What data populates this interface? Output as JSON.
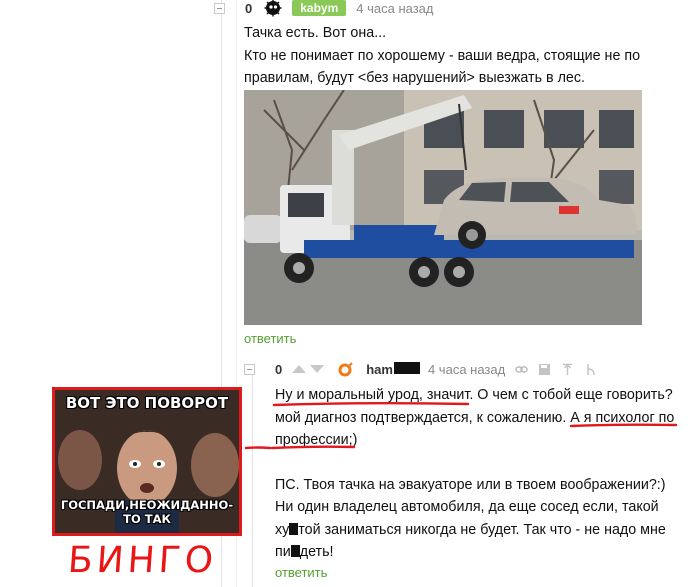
{
  "comment1": {
    "rating": "0",
    "author_badge": "kabym",
    "time": "4 часа назад",
    "lines": [
      "Тачка есть. Вот она...",
      "Кто не понимает по хорошему - ваши ведра, стоящие не по",
      "правилам, будут <без нарушений> выезжать в лес."
    ],
    "reply_label": "ответить",
    "avatar_icon": "black-fluffy-avatar-icon"
  },
  "comment2": {
    "rating": "0",
    "username": "ham",
    "time": "4 часа назад",
    "paragraph1": {
      "l1_a": "Ну и моральный урод, значит",
      "l1_b": ". О чем с тобой еще говорить?",
      "l2_a": "мой диагноз подтверждается, к сожалению. ",
      "l2_b": "А я психолог по",
      "l3": "профессии;)"
    },
    "paragraph2": {
      "l1": "ПС. Твоя тачка на эвакуаторе или в твоем воображении?:)",
      "l2": "Ни один владелец автомобиля, да еще сосед если, такой",
      "l3_a": "ху",
      "l3_b": "той заниматься никогда не будет. Так что - не надо мне",
      "l4_a": "пи",
      "l4_b": "деть!"
    },
    "reply_label": "ответить",
    "avatar_icon": "orange-avatar-icon",
    "tool_icons": [
      "link-icon",
      "save-icon",
      "pin-icon",
      "thread-icon"
    ]
  },
  "meme": {
    "top_text": "ВОТ ЭТО ПОВОРОТ",
    "bottom_text": "ГОСПАДИ,НЕОЖИДАННО-ТО ТАК"
  },
  "annotation": {
    "bingo": "БИНГО",
    "accent_color": "#e0191d"
  },
  "colors": {
    "reply_green": "#55a031",
    "badge_green": "#8ac858",
    "meta_gray": "#888888"
  }
}
